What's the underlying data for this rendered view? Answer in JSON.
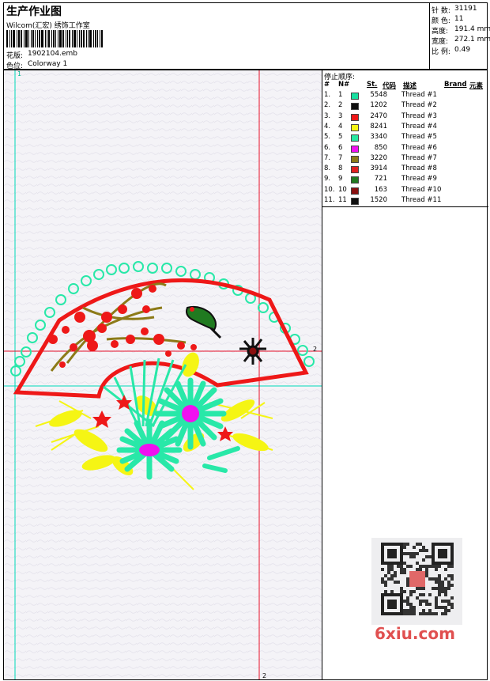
{
  "header": {
    "title": "生产作业图",
    "company": "Wilcom(汇宏) 绣饰工作室",
    "design_label": "花版:",
    "design_value": "1902104.emb",
    "colorway_label": "色位:",
    "colorway_value": "Colorway 1"
  },
  "stats": [
    {
      "label": "针 数:",
      "value": "31191"
    },
    {
      "label": "颜 色:",
      "value": "11"
    },
    {
      "label": "高度:",
      "value": "191.4 mm"
    },
    {
      "label": "宽度:",
      "value": "272.1 mm"
    },
    {
      "label": "比 例:",
      "value": "0.49"
    }
  ],
  "guides": {
    "top_left": "1",
    "right": "2",
    "bottom": "2"
  },
  "stop_sequence": {
    "title": "停止顺序:",
    "columns": [
      "#",
      "N#",
      "St.",
      "代码",
      "描述",
      "Brand",
      "元素"
    ],
    "rows": [
      {
        "idx": "1.",
        "n": "1",
        "color": "#18e0a0",
        "st": "5548",
        "desc": "Thread #1"
      },
      {
        "idx": "2.",
        "n": "2",
        "color": "#101010",
        "st": "1202",
        "desc": "Thread #2"
      },
      {
        "idx": "3.",
        "n": "3",
        "color": "#ee1818",
        "st": "2470",
        "desc": "Thread #3"
      },
      {
        "idx": "4.",
        "n": "4",
        "color": "#f5f514",
        "st": "8241",
        "desc": "Thread #4"
      },
      {
        "idx": "5.",
        "n": "5",
        "color": "#28e8a0",
        "st": "3340",
        "desc": "Thread #5"
      },
      {
        "idx": "6.",
        "n": "6",
        "color": "#f010f0",
        "st": "850",
        "desc": "Thread #6"
      },
      {
        "idx": "7.",
        "n": "7",
        "color": "#8c7a18",
        "st": "3220",
        "desc": "Thread #7"
      },
      {
        "idx": "8.",
        "n": "8",
        "color": "#e02020",
        "st": "3914",
        "desc": "Thread #8"
      },
      {
        "idx": "9.",
        "n": "9",
        "color": "#207a20",
        "st": "721",
        "desc": "Thread #9"
      },
      {
        "idx": "10.",
        "n": "10",
        "color": "#8a1010",
        "st": "163",
        "desc": "Thread #10"
      },
      {
        "idx": "11.",
        "n": "11",
        "color": "#101010",
        "st": "1520",
        "desc": "Thread #11"
      }
    ]
  },
  "watermark": "6xiu.com",
  "colors": {
    "guide_red": "#e8102a",
    "guide_green": "#00d8b8",
    "fan_red": "#ee1818",
    "teal": "#28e8a8",
    "yellow": "#f5f514"
  }
}
